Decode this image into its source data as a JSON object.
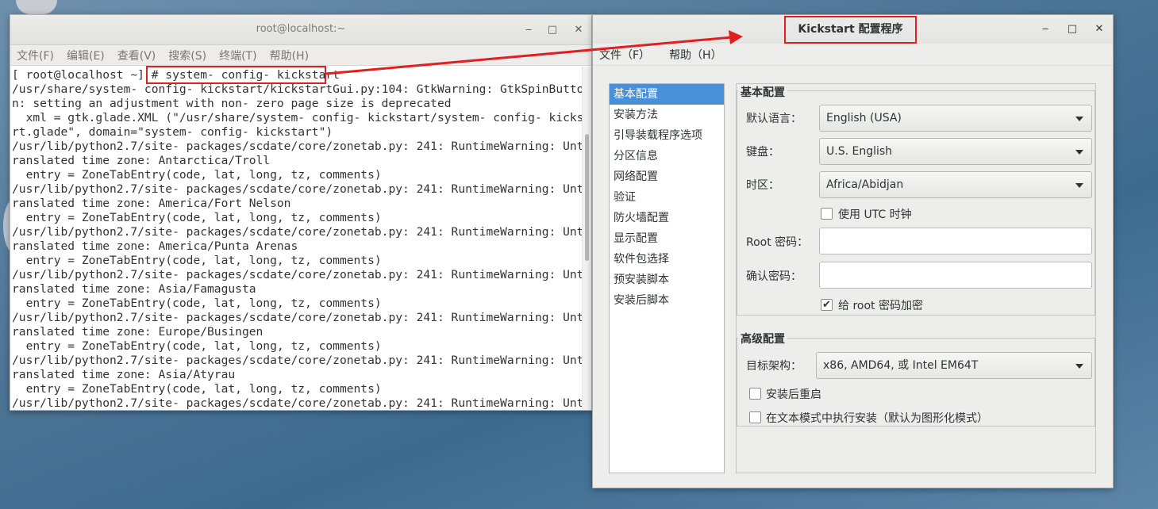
{
  "terminal": {
    "title": "root@localhost:~",
    "window_buttons": {
      "minimize": "‒",
      "maximize": "□",
      "close": "✕"
    },
    "menu": [
      "文件(F)",
      "编辑(E)",
      "查看(V)",
      "搜索(S)",
      "终端(T)",
      "帮助(H)"
    ],
    "prompt": "[ root@localhost ~] # ",
    "command": "system- config- kickstart",
    "lines": [
      "/usr/share/system- config- kickstart/kickstartGui.py:104: GtkWarning: GtkSpinButto",
      "n: setting an adjustment with non- zero page size is deprecated",
      "  xml = gtk.glade.XML (\"/usr/share/system- config- kickstart/system- config- kicksta",
      "rt.glade\", domain=\"system- config- kickstart\")",
      "/usr/lib/python2.7/site- packages/scdate/core/zonetab.py: 241: RuntimeWarning: Unt",
      "ranslated time zone: Antarctica/Troll",
      "  entry = ZoneTabEntry(code, lat, long, tz, comments)",
      "/usr/lib/python2.7/site- packages/scdate/core/zonetab.py: 241: RuntimeWarning: Unt",
      "ranslated time zone: America/Fort Nelson",
      "  entry = ZoneTabEntry(code, lat, long, tz, comments)",
      "/usr/lib/python2.7/site- packages/scdate/core/zonetab.py: 241: RuntimeWarning: Unt",
      "ranslated time zone: America/Punta Arenas",
      "  entry = ZoneTabEntry(code, lat, long, tz, comments)",
      "/usr/lib/python2.7/site- packages/scdate/core/zonetab.py: 241: RuntimeWarning: Unt",
      "ranslated time zone: Asia/Famagusta",
      "  entry = ZoneTabEntry(code, lat, long, tz, comments)",
      "/usr/lib/python2.7/site- packages/scdate/core/zonetab.py: 241: RuntimeWarning: Unt",
      "ranslated time zone: Europe/Busingen",
      "  entry = ZoneTabEntry(code, lat, long, tz, comments)",
      "/usr/lib/python2.7/site- packages/scdate/core/zonetab.py: 241: RuntimeWarning: Unt",
      "ranslated time zone: Asia/Atyrau",
      "  entry = ZoneTabEntry(code, lat, long, tz, comments)",
      "/usr/lib/python2.7/site- packages/scdate/core/zonetab.py: 241: RuntimeWarning: Unt"
    ]
  },
  "kickstart": {
    "title": "Kickstart 配置程序",
    "window_buttons": {
      "minimize": "‒",
      "maximize": "□",
      "close": "✕"
    },
    "menu": [
      "文件（F）",
      "帮助（H）"
    ],
    "nav": [
      "基本配置",
      "安装方法",
      "引导装载程序选项",
      "分区信息",
      "网络配置",
      "验证",
      "防火墙配置",
      "显示配置",
      "软件包选择",
      "预安装脚本",
      "安装后脚本"
    ],
    "nav_selected": "基本配置",
    "basic": {
      "section_title": "基本配置",
      "language_label": "默认语言：",
      "language_value": "English (USA)",
      "keyboard_label": "键盘：",
      "keyboard_value": "U.S. English",
      "timezone_label": "时区：",
      "timezone_value": "Africa/Abidjan",
      "utc_label": "使用  UTC 时钟",
      "utc_checked": false,
      "root_pw_label": "Root 密码：",
      "root_pw_value": "",
      "confirm_pw_label": "确认密码：",
      "confirm_pw_value": "",
      "encrypt_label": "给  root 密码加密",
      "encrypt_checked": true,
      "check_mark": "✔"
    },
    "advanced": {
      "section_title": "高级配置",
      "arch_label": "目标架构：",
      "arch_value": "x86, AMD64, 或  Intel EM64T",
      "reboot_label": "安装后重启",
      "reboot_checked": false,
      "text_mode_label": "在文本模式中执行安装（默认为图形化模式）",
      "text_mode_checked": false
    }
  },
  "colors": {
    "annotation_red": "#e02020",
    "selection_blue": "#4a90d9"
  }
}
